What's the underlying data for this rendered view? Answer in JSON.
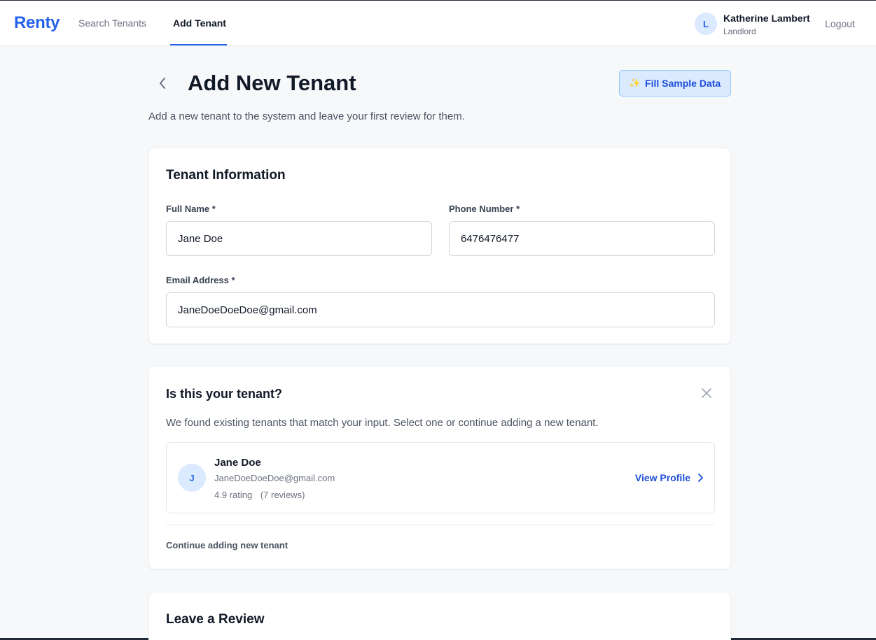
{
  "nav": {
    "logo": "Renty",
    "links": [
      "Search Tenants",
      "Add Tenant"
    ],
    "active_link": "Add Tenant",
    "user": {
      "initial": "L",
      "name": "Katherine Lambert",
      "role": "Landlord"
    },
    "logout": "Logout"
  },
  "header": {
    "title": "Add New Tenant",
    "subtitle": "Add a new tenant to the system and leave your first review for them.",
    "fill_button": "Fill Sample Data"
  },
  "tenant_info": {
    "title": "Tenant Information",
    "full_name": {
      "label": "Full Name *",
      "value": "Jane Doe"
    },
    "phone": {
      "label": "Phone Number *",
      "value": "6476476477"
    },
    "email": {
      "label": "Email Address *",
      "value": "JaneDoeDoeDoe@gmail.com"
    }
  },
  "match": {
    "title": "Is this your tenant?",
    "description": "We found existing tenants that match your input. Select one or continue adding a new tenant.",
    "tenant": {
      "initial": "J",
      "name": "Jane Doe",
      "email": "JaneDoeDoeDoe@gmail.com",
      "rating": "4.9 rating",
      "reviews": "(7 reviews)",
      "view_profile": "View Profile"
    },
    "continue": "Continue adding new tenant"
  },
  "review": {
    "title": "Leave a Review"
  },
  "colors": {
    "accent": "#2563eb",
    "accent_light": "#dbeafe",
    "background": "#f7f8fa"
  }
}
